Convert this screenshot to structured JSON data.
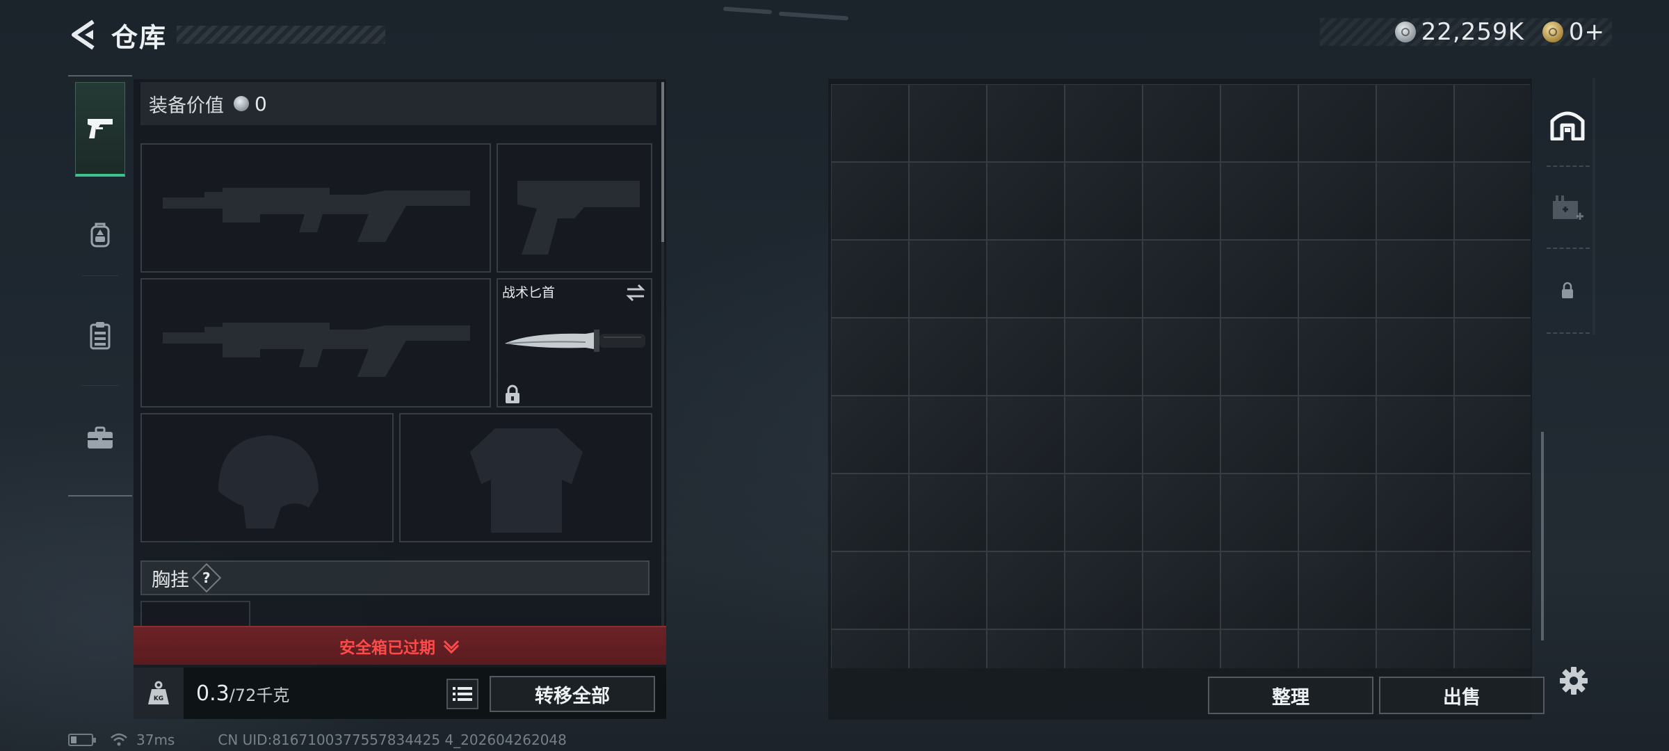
{
  "header": {
    "title": "仓库",
    "back_icon": "back-arrow-icon",
    "currencies": [
      {
        "icon": "silver-coin-icon",
        "value": "22,259K"
      },
      {
        "icon": "gold-coin-icon",
        "value": "0+"
      }
    ]
  },
  "left_rail": {
    "items": [
      {
        "name": "weapons",
        "icon": "pistol-icon",
        "active": true
      },
      {
        "name": "backpack",
        "icon": "backpack-icon",
        "active": false
      },
      {
        "name": "rig",
        "icon": "clipboard-icon",
        "active": false
      },
      {
        "name": "case",
        "icon": "briefcase-icon",
        "active": false
      }
    ]
  },
  "loadout": {
    "value_label": "装备价值",
    "value": "0",
    "slots": [
      {
        "type": "primary-weapon",
        "icon": "rifle-icon",
        "empty": true
      },
      {
        "type": "sidearm",
        "icon": "pistol-icon",
        "empty": true
      },
      {
        "type": "secondary-weapon",
        "icon": "rifle-icon",
        "empty": true
      },
      {
        "type": "melee",
        "label": "战术匕首",
        "icon": "knife-icon",
        "empty": false,
        "locked": true
      },
      {
        "type": "helmet",
        "icon": "helmet-icon",
        "empty": true
      },
      {
        "type": "armor",
        "icon": "armor-icon",
        "empty": true
      }
    ],
    "rig_label": "胸挂",
    "rig_help": "?",
    "safe_box_status": "安全箱已过期",
    "weight_current": "0.3",
    "weight_max": "/72千克",
    "weight_icon_text": "KG",
    "transfer_all_label": "转移全部"
  },
  "storage": {
    "sort_label": "整理",
    "sell_label": "出售",
    "side_tabs": [
      {
        "icon": "storage-icon",
        "active": true
      },
      {
        "icon": "expand-storage-icon",
        "active": false
      },
      {
        "icon": "lock-icon",
        "active": false
      }
    ]
  },
  "status": {
    "ping": "37ms",
    "uid": "CN UID:8167100377557834425 4_202604262048"
  },
  "colors": {
    "accent": "#3cc48f",
    "warning": "#ff4a4a",
    "warning_bg": "#6b2226"
  }
}
